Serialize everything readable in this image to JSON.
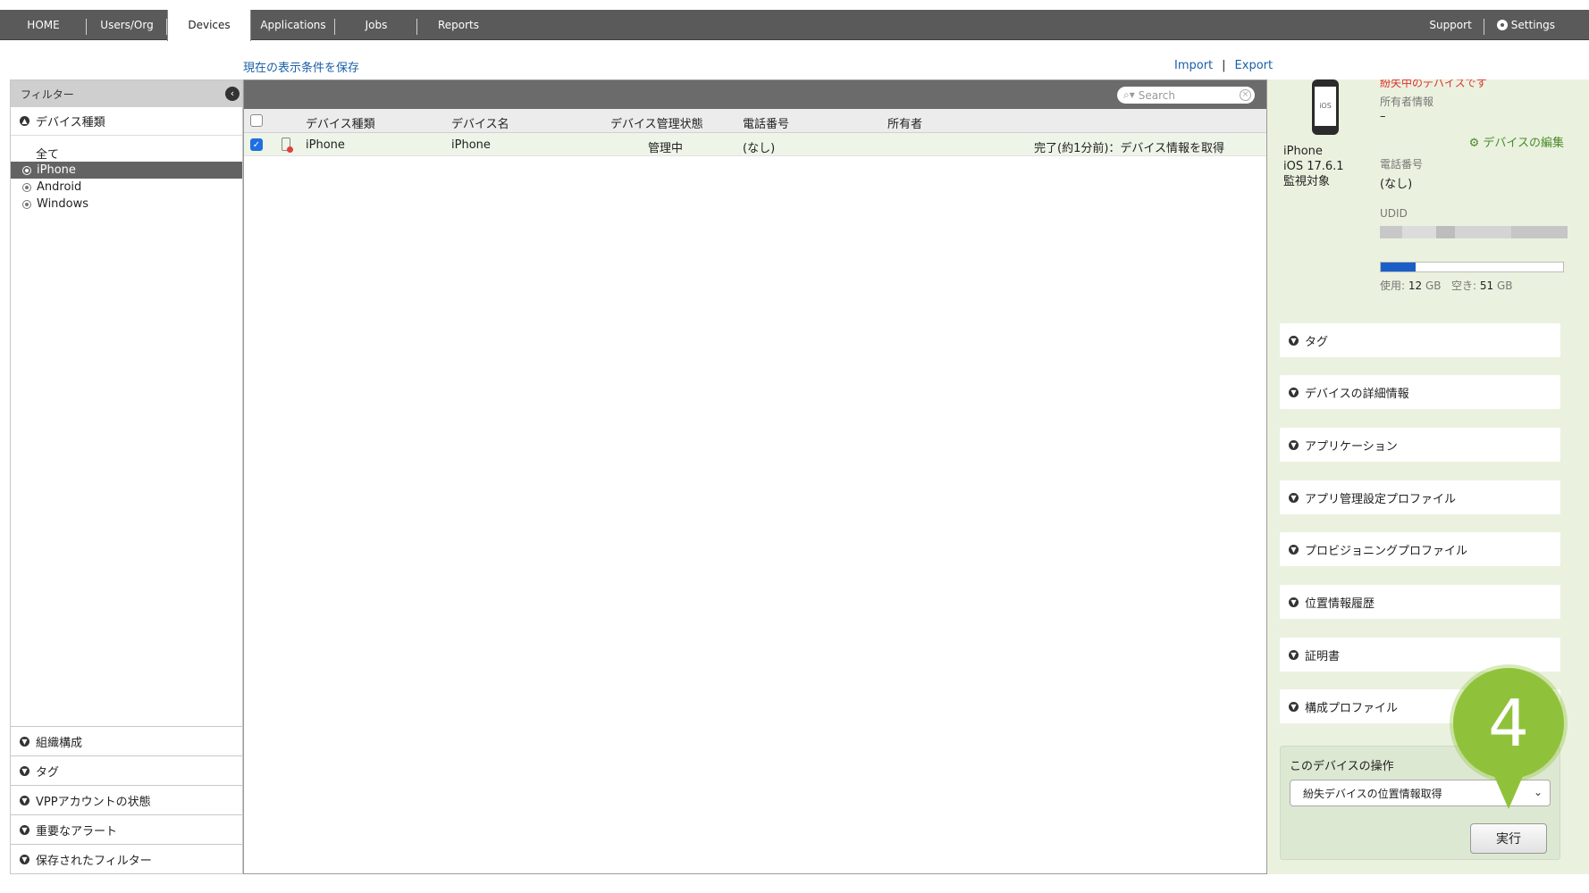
{
  "nav": {
    "tabs": [
      "HOME",
      "Users/Org",
      "Devices",
      "Applications",
      "Jobs",
      "Reports"
    ],
    "active": "Devices",
    "right": {
      "support": "Support",
      "settings": "Settings"
    }
  },
  "toolbar": {
    "save_filter_link": "現在の表示条件を保存",
    "import": "Import",
    "separator": "|",
    "export": "Export"
  },
  "sidebar": {
    "header": "フィルター",
    "collapse_icon": "‹",
    "device_type_section": "デバイス種類",
    "all_label": "全て",
    "items": [
      "iPhone",
      "Android",
      "Windows"
    ],
    "selected_item": "iPhone",
    "bottom_sections": [
      "組織構成",
      "タグ",
      "VPPアカウントの状態",
      "重要なアラート",
      "保存されたフィルター"
    ]
  },
  "grid": {
    "search_placeholder": "Search",
    "columns": [
      "デバイス種類",
      "デバイス名",
      "デバイス管理状態",
      "電話番号",
      "所有者"
    ],
    "rows": [
      {
        "checked": true,
        "type": "iPhone",
        "name": "iPhone",
        "status": "管理中",
        "phone": "(なし)",
        "owner": "",
        "last_job": "完了(約1分前)：デバイス情報を取得"
      }
    ]
  },
  "detail": {
    "lost_notice": "紛失中のデバイスです",
    "phone_screen_text": "iOS",
    "device_name": "iPhone",
    "os_version": "iOS 17.6.1",
    "supervised": "監視対象",
    "owner_label": "所有者情報",
    "owner_value": "–",
    "edit_link": "デバイスの編集",
    "phone_label": "電話番号",
    "phone_value": "(なし)",
    "udid_label": "UDID",
    "storage": {
      "used_fraction": 0.19,
      "used_label": "使用:",
      "used_value": "12",
      "used_unit": "GB",
      "free_label": "空き:",
      "free_value": "51",
      "free_unit": "GB"
    },
    "accordions": [
      "タグ",
      "デバイスの詳細情報",
      "アプリケーション",
      "アプリ管理設定プロファイル",
      "プロビジョニングプロファイル",
      "位置情報履歴",
      "証明書",
      "構成プロファイル"
    ],
    "operations": {
      "title": "このデバイスの操作",
      "selected_action": "紛失デバイスの位置情報取得",
      "run_button": "実行"
    }
  },
  "callout": {
    "number": "4"
  },
  "colors": {
    "accent_green": "#8fc23a",
    "link_blue": "#1a5fa8",
    "alert_red": "#e0302a"
  }
}
